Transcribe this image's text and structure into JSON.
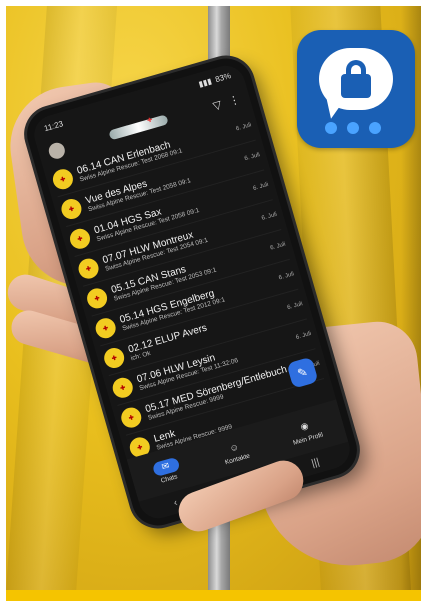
{
  "statusbar": {
    "time": "11:23",
    "battery": "83%"
  },
  "chats": [
    {
      "name": "06.14 CAN Erlenbach",
      "preview": "Swiss Alpine Rescue: Test 2068 09:1",
      "meta": "6. Juli",
      "badge": ""
    },
    {
      "name": "Vue des Alpes",
      "preview": "Swiss Alpine Rescue: Test 2058 09:1",
      "meta": "6. Juli",
      "badge": ""
    },
    {
      "name": "01.04 HGS Sax",
      "preview": "Swiss Alpine Rescue: Test 2058 09:1",
      "meta": "6. Juli",
      "badge": ""
    },
    {
      "name": "07.07 HLW Montreux",
      "preview": "Swiss Alpine Rescue: Test 2054 09:1",
      "meta": "6. Juli",
      "badge": ""
    },
    {
      "name": "05.15 CAN Stans",
      "preview": "Swiss Alpine Rescue: Test 2053 09:1",
      "meta": "6. Juli",
      "badge": ""
    },
    {
      "name": "05.14 HGS Engelberg",
      "preview": "Swiss Alpine Rescue: Test 2012 09:1",
      "meta": "6. Juli",
      "badge": ""
    },
    {
      "name": "02.12 ELUP Avers",
      "preview": "ich: Ok",
      "meta": "6. Juli",
      "badge": ""
    },
    {
      "name": "07.06 HLW Leysin",
      "preview": "Swiss Alpine Rescue: Test 11:32:06",
      "meta": "6. Juli",
      "badge": ""
    },
    {
      "name": "05.17 MED Sörenberg/Entlebuch",
      "preview": "Swiss Alpine Rescue: 9999",
      "meta": "5. Juli",
      "badge": ""
    },
    {
      "name": "Lenk",
      "preview": "Swiss Alpine Rescue: 9999",
      "meta": "",
      "badge": ""
    }
  ],
  "nav": {
    "chats": "Chats",
    "contacts": "Kontakte",
    "profile": "Mein Profil"
  },
  "colors": {
    "jacket": "#f2cc21",
    "accent": "#2f6fe0",
    "app_icon": "#1a5fb4"
  }
}
